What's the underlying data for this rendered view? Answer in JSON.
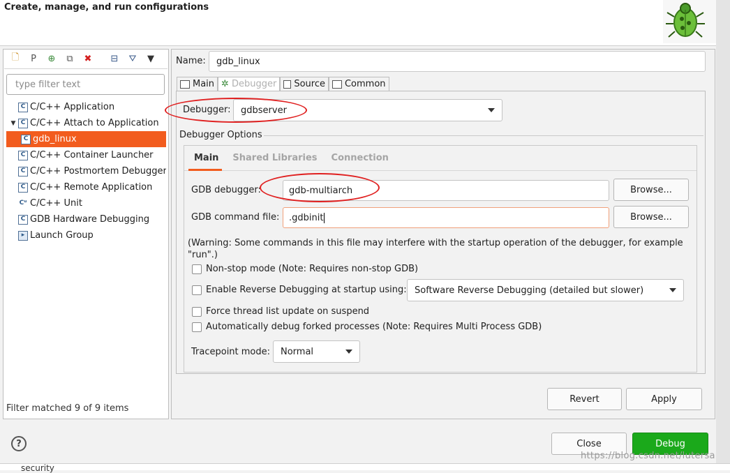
{
  "header": {
    "title": "Create, manage, and run configurations"
  },
  "left": {
    "toolbar": [
      {
        "name": "new-config-icon",
        "glyph": "🗋",
        "color": "#c98a1a"
      },
      {
        "name": "new-prototype-icon",
        "glyph": "P",
        "color": "#555555"
      },
      {
        "name": "export-icon",
        "glyph": "⊕",
        "color": "#3a8a3a"
      },
      {
        "name": "duplicate-icon",
        "glyph": "⧉",
        "color": "#555555"
      },
      {
        "name": "delete-icon",
        "glyph": "✖",
        "color": "#d42020"
      },
      {
        "name": "collapse-all-icon",
        "glyph": "⊟",
        "color": "#3a5a8a"
      },
      {
        "name": "filter-icon",
        "glyph": "⛛",
        "color": "#3a5a8a"
      },
      {
        "name": "menu-dropdown-icon",
        "glyph": "▼",
        "color": "#333333"
      }
    ],
    "filter_placeholder": "type filter text",
    "items": [
      {
        "label": "C/C++ Application"
      },
      {
        "label": "C/C++ Attach to Application"
      },
      {
        "label": "gdb_linux"
      },
      {
        "label": "C/C++ Container Launcher"
      },
      {
        "label": "C/C++ Postmortem Debugger"
      },
      {
        "label": "C/C++ Remote Application"
      },
      {
        "label": "C/C++ Unit"
      },
      {
        "label": "GDB Hardware Debugging"
      },
      {
        "label": "Launch Group"
      }
    ],
    "status": "Filter matched 9 of 9 items"
  },
  "right": {
    "name_label": "Name:",
    "name_value": "gdb_linux",
    "tabs": [
      {
        "label": "Main"
      },
      {
        "label": "Debugger"
      },
      {
        "label": "Source"
      },
      {
        "label": "Common"
      }
    ],
    "debugger_label": "Debugger:",
    "debugger_value": "gdbserver",
    "options_label": "Debugger Options",
    "inner_tabs": [
      {
        "label": "Main"
      },
      {
        "label": "Shared Libraries"
      },
      {
        "label": "Connection"
      }
    ],
    "gdb_debugger_label": "GDB debugger:",
    "gdb_debugger_value": "gdb-multiarch",
    "gdb_command_label": "GDB command file:",
    "gdb_command_value": ".gdbinit",
    "browse_label": "Browse...",
    "warning": "(Warning: Some commands in this file may interfere with the startup operation of the debugger, for example \"run\".)",
    "nonstop": "Non-stop mode (Note: Requires non-stop GDB)",
    "reverse": "Enable Reverse Debugging at startup using:",
    "reverse_value": "Software Reverse Debugging (detailed but slower)",
    "force_thread": "Force thread list update on suspend",
    "auto_fork": "Automatically debug forked processes (Note: Requires Multi Process GDB)",
    "tracepoint_label": "Tracepoint mode:",
    "tracepoint_value": "Normal",
    "revert": "Revert",
    "apply": "Apply"
  },
  "footer": {
    "help": "?",
    "close": "Close",
    "debug": "Debug",
    "watermark": "https://blog.csdn.net/lutersa",
    "peek": "security"
  }
}
